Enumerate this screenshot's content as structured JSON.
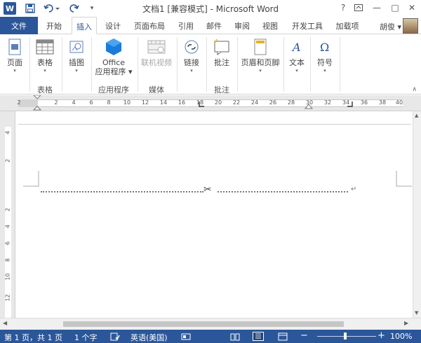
{
  "titlebar": {
    "title": "文档1 [兼容模式] - Microsoft Word",
    "app_logo": "W",
    "save_icon": "save-icon",
    "undo_icon": "undo-icon",
    "redo_icon": "redo-icon",
    "help": "?",
    "minimize": "—",
    "restore": "□",
    "close": "✕"
  },
  "tabs": [
    "文件",
    "开始",
    "插入",
    "设计",
    "页面布局",
    "引用",
    "邮件",
    "审阅",
    "视图",
    "开发工具",
    "加载项"
  ],
  "user": {
    "name": "胡俊 ▾"
  },
  "ribbon": {
    "buttons": [
      {
        "label": "页面",
        "arrow": "▾"
      },
      {
        "label": "表格",
        "arrow": "▾"
      },
      {
        "label": "插图",
        "arrow": "▾"
      },
      {
        "label": "Office\n应用程序 ▾"
      },
      {
        "label": "联机视频"
      },
      {
        "label": "链接",
        "arrow": "▾"
      },
      {
        "label": "批注"
      },
      {
        "label": "页眉和页脚",
        "arrow": "▾"
      },
      {
        "label": "文本",
        "arrow": "▾"
      },
      {
        "label": "符号",
        "arrow": "▾"
      }
    ],
    "groups": [
      "表格",
      "应用程序",
      "媒体",
      "批注"
    ],
    "collapse": "∧"
  },
  "ruler": {
    "tab_selector": "L",
    "numbers": [
      "2",
      "2",
      "4",
      "6",
      "8",
      "10",
      "12",
      "14",
      "16",
      "18",
      "20",
      "22",
      "24",
      "26",
      "28",
      "30",
      "32",
      "34",
      "36",
      "38",
      "40"
    ],
    "vertical_numbers": [
      "4",
      "2",
      "2",
      "4",
      "6",
      "8",
      "10",
      "12"
    ]
  },
  "document": {
    "scissors": "✂",
    "para_mark": "↵"
  },
  "status": {
    "page": "第 1 页，共 1 页",
    "words": "1 个字",
    "lang": "英语(美国)",
    "zoom_minus": "−",
    "zoom_plus": "+",
    "zoom": "100%",
    "zoom_level": 1.0
  }
}
